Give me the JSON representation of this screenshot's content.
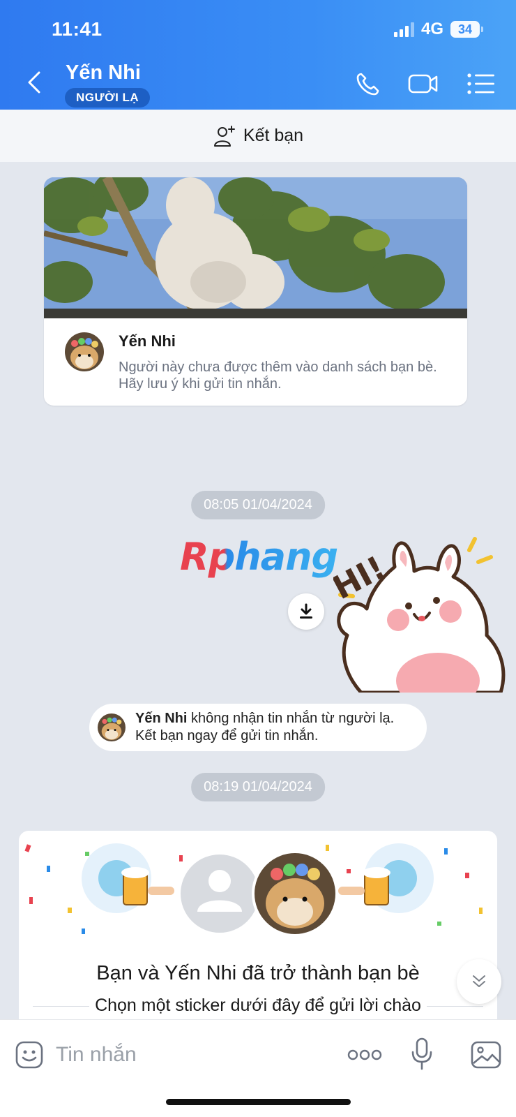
{
  "status_bar": {
    "time": "11:41",
    "network": "4G",
    "battery": "34"
  },
  "header": {
    "contact_name": "Yến Nhi",
    "badge": "NGƯỜI LẠ",
    "icons": [
      "back-icon",
      "phone-icon",
      "video-call-icon",
      "list-menu-icon"
    ]
  },
  "add_friend": {
    "label": "Kết bạn",
    "icon": "add-user-icon"
  },
  "profile_card": {
    "name": "Yến Nhi",
    "note": "Người này chưa được thêm vào danh sách bạn bè. Hãy lưu ý khi gửi tin nhắn."
  },
  "messages": {
    "timestamp_1": "08:05 01/04/2024",
    "watermark": "Rphang",
    "sticker_text": "HI!",
    "notice_name": "Yến Nhi",
    "notice_text_1": " không nhận tin nhắn từ người lạ.",
    "notice_text_2": "Kết bạn ngay để gửi tin nhắn.",
    "timestamp_2": "08:19 01/04/2024"
  },
  "friend_card": {
    "title": "Bạn và Yến Nhi đã trở thành bạn bè",
    "subtitle": "Chọn một sticker dưới đây để gửi lời chào"
  },
  "composer": {
    "placeholder": "Tin nhắn"
  },
  "colors": {
    "header_blue": "#2f7af0",
    "badge_blue": "#1d5fc4",
    "chat_bg": "#e3e7ee"
  }
}
